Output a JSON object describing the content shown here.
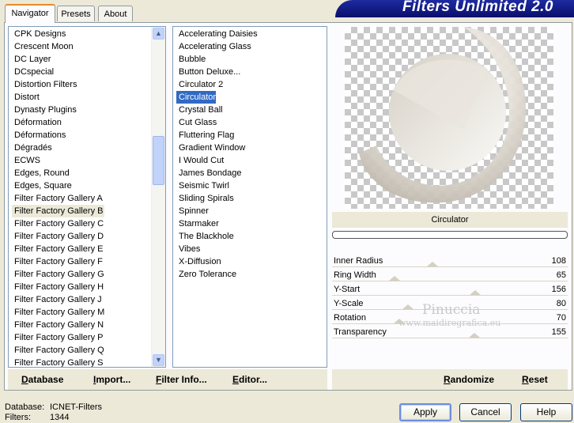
{
  "tabs": [
    "Navigator",
    "Presets",
    "About"
  ],
  "banner_title": "Filters Unlimited 2.0",
  "categories": [
    "CPK Designs",
    "Crescent Moon",
    "DC Layer",
    "DCspecial",
    "Distortion Filters",
    "Distort",
    "Dynasty Plugins",
    "Déformation",
    "Déformations",
    "Dégradés",
    "ECWS",
    "Edges, Round",
    "Edges, Square",
    "Filter Factory Gallery A",
    "Filter Factory Gallery B",
    "Filter Factory Gallery C",
    "Filter Factory Gallery D",
    "Filter Factory Gallery E",
    "Filter Factory Gallery F",
    "Filter Factory Gallery G",
    "Filter Factory Gallery H",
    "Filter Factory Gallery J",
    "Filter Factory Gallery M",
    "Filter Factory Gallery N",
    "Filter Factory Gallery P",
    "Filter Factory Gallery Q",
    "Filter Factory Gallery S"
  ],
  "selected_category": "Filter Factory Gallery B",
  "filters": [
    "Accelerating Daisies",
    "Accelerating Glass",
    "Bubble",
    "Button Deluxe...",
    "Circulator 2",
    "Circulator",
    "Crystal Ball",
    "Cut Glass",
    "Fluttering Flag",
    "Gradient Window",
    "I Would Cut",
    "James Bondage",
    "Seismic Twirl",
    "Sliding Spirals",
    "Spinner",
    "Starmaker",
    "The Blackhole",
    "Vibes",
    "X-Diffusion",
    "Zero Tolerance"
  ],
  "selected_filter": "Circulator",
  "links": {
    "database": "Database",
    "import": "Import...",
    "filter_info": "Filter Info...",
    "editor": "Editor...",
    "randomize": "Randomize",
    "reset": "Reset"
  },
  "preview_filter_name": "Circulator",
  "parameters": [
    {
      "name": "Inner Radius",
      "value": 108
    },
    {
      "name": "Ring Width",
      "value": 65
    },
    {
      "name": "Y-Start",
      "value": 156
    },
    {
      "name": "Y-Scale",
      "value": 80
    },
    {
      "name": "Rotation",
      "value": 70
    },
    {
      "name": "Transparency",
      "value": 155
    }
  ],
  "watermark": {
    "line1": "Pinuccia",
    "line2": "www.maidiregrafica.eu"
  },
  "status": {
    "database_label": "Database:",
    "database_value": "ICNET-Filters",
    "filters_label": "Filters:",
    "filters_value": "1344"
  },
  "buttons": {
    "apply": "Apply",
    "cancel": "Cancel",
    "help": "Help"
  },
  "colors": {
    "selection_blue": "#316ac5",
    "banner": "#0a0f6b",
    "tab_accent": "#e68b2c"
  }
}
